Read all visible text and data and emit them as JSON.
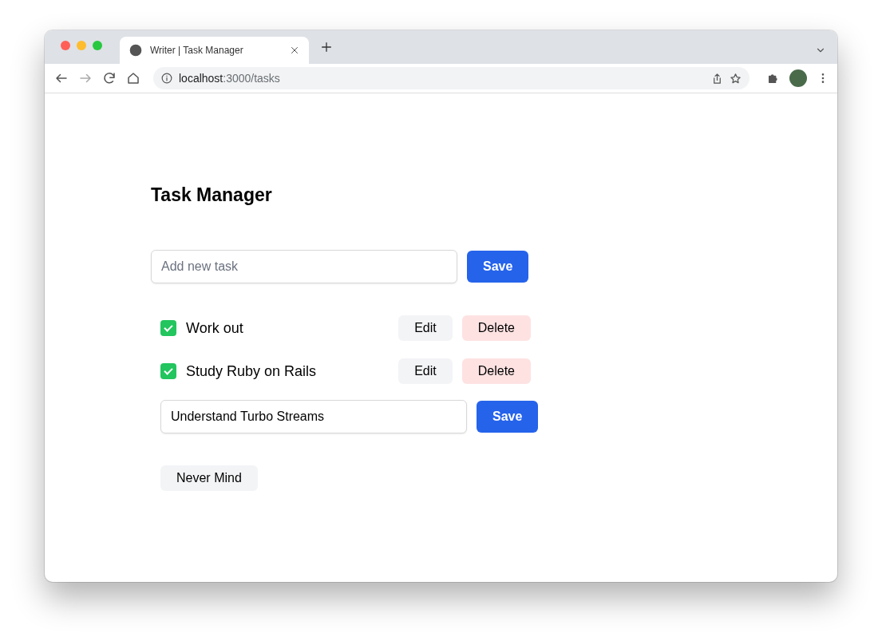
{
  "browser": {
    "tab_title": "Writer | Task Manager",
    "url": {
      "host": "localhost",
      "path": ":3000/tasks"
    }
  },
  "page": {
    "title": "Task Manager",
    "new_task": {
      "placeholder": "Add new task",
      "button": "Save"
    },
    "tasks": [
      {
        "kind": "item",
        "label": "Work out",
        "checked": true,
        "edit": "Edit",
        "delete": "Delete"
      },
      {
        "kind": "item",
        "label": "Study Ruby on Rails",
        "checked": true,
        "edit": "Edit",
        "delete": "Delete"
      },
      {
        "kind": "editing",
        "value": "Understand Turbo Streams",
        "button": "Save",
        "cancel": "Never Mind"
      }
    ]
  }
}
